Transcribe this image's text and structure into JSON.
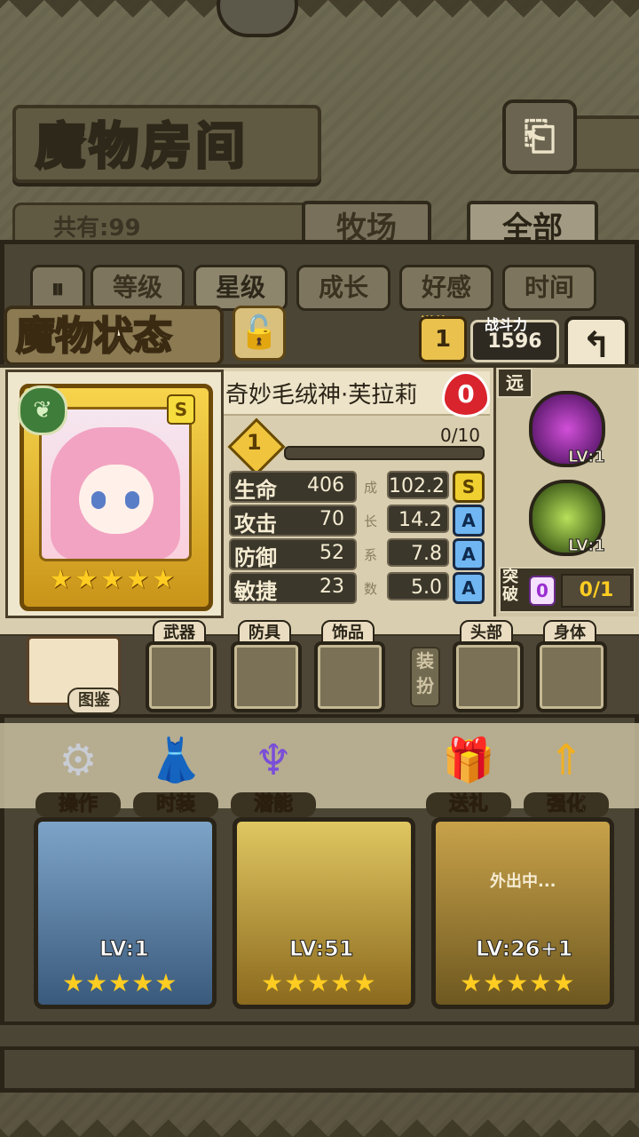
{
  "header": {
    "title": "魔物房间",
    "owned": "共有:99"
  },
  "tabs": [
    {
      "label": "牧场",
      "active": false
    },
    {
      "label": "全部",
      "active": true
    }
  ],
  "sort_buttons": [
    {
      "label": "等级",
      "active": false
    },
    {
      "label": "星级",
      "active": true
    },
    {
      "label": "成长",
      "active": false
    },
    {
      "label": "好感",
      "active": false
    },
    {
      "label": "时间",
      "active": false
    }
  ],
  "status": {
    "title": "魔物状态",
    "potential_label": "潜能",
    "potential_value": "1",
    "power_label": "战斗力",
    "power_value": "1596"
  },
  "monster": {
    "name": "奇妙毛绒神·芙拉莉",
    "affection": "0",
    "rank": "S",
    "level": "1",
    "exp": "0/10",
    "exp_fraction": 0,
    "stars": "★★★★★",
    "stats": [
      {
        "label": "生命",
        "value": "406",
        "growth": "102.2",
        "grade": "S"
      },
      {
        "label": "攻击",
        "value": "70",
        "growth": "14.2",
        "grade": "A"
      },
      {
        "label": "防御",
        "value": "52",
        "growth": "7.8",
        "grade": "A"
      },
      {
        "label": "敏捷",
        "value": "23",
        "growth": "5.0",
        "grade": "A"
      }
    ],
    "growth_label": [
      "成",
      "长",
      "系",
      "数"
    ]
  },
  "skills": {
    "range": "远",
    "skill1_level": "LV:1",
    "skill2_level": "LV:1",
    "break_label": "突破",
    "break_count": "0",
    "break_progress": "0/1"
  },
  "equipment": {
    "book_label": "图鉴",
    "slots": [
      "武器",
      "防具",
      "饰品",
      "头部",
      "身体"
    ],
    "equip_button": "装扮"
  },
  "actions": [
    {
      "label": "操作",
      "icon": "gear-icon"
    },
    {
      "label": "时装",
      "icon": "outfit-icon"
    },
    {
      "label": "潜能",
      "icon": "potential-icon"
    },
    {
      "label": "送礼",
      "icon": "gift-icon"
    },
    {
      "label": "强化",
      "icon": "upgrade-icon"
    }
  ],
  "monster_cards": [
    {
      "level": "LV:1",
      "stars": "★★★★★",
      "status": ""
    },
    {
      "level": "LV:51",
      "stars": "★★★★★",
      "status": ""
    },
    {
      "level": "LV:26+1",
      "stars": "★★★★★",
      "status": "外出中..."
    }
  ],
  "colors": {
    "gold": "#f0c53d",
    "panel": "#d9ceaf",
    "dark": "#2a2418",
    "grade_s": "#f0d030",
    "grade_a": "#6fb6f2"
  }
}
